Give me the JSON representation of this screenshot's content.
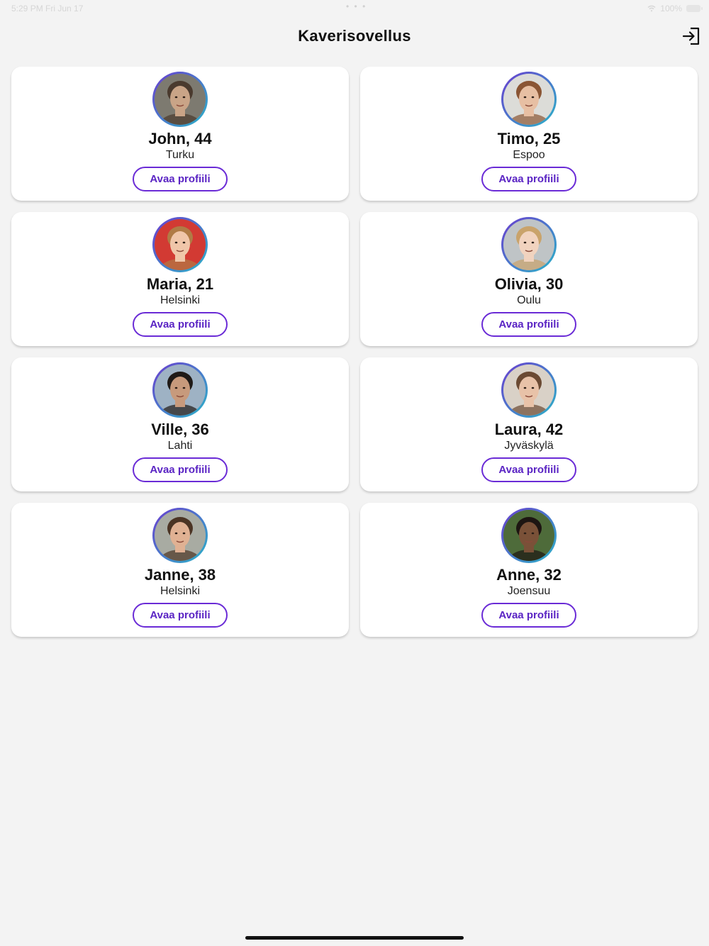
{
  "status_bar": {
    "time": "5:29 PM   Fri Jun 17",
    "dots": "• • •",
    "battery_text": "100%"
  },
  "header": {
    "title": "Kaverisovellus",
    "login_icon": "login-icon"
  },
  "accent_color": "#6a2bd6",
  "profiles": [
    {
      "name": "John, 44",
      "city": "Turku",
      "button": "Avaa profiili",
      "skin": "#c9a487",
      "hair": "#4a3a2e",
      "bg": "#7d7a70"
    },
    {
      "name": "Timo, 25",
      "city": "Espoo",
      "button": "Avaa profiili",
      "skin": "#e7bfa3",
      "hair": "#8a5534",
      "bg": "#dcdcd8"
    },
    {
      "name": "Maria, 21",
      "city": "Helsinki",
      "button": "Avaa profiili",
      "skin": "#f0c6a9",
      "hair": "#b07b45",
      "bg": "#d23a33"
    },
    {
      "name": "Olivia, 30",
      "city": "Oulu",
      "button": "Avaa profiili",
      "skin": "#f1d3bf",
      "hair": "#c9a36b",
      "bg": "#bfc4c6"
    },
    {
      "name": "Ville, 36",
      "city": "Lahti",
      "button": "Avaa profiili",
      "skin": "#c79a7c",
      "hair": "#1f1a17",
      "bg": "#9eb2c4"
    },
    {
      "name": "Laura, 42",
      "city": "Jyväskylä",
      "button": "Avaa profiili",
      "skin": "#e8c2a8",
      "hair": "#6b4a33",
      "bg": "#d9d1c7"
    },
    {
      "name": "Janne, 38",
      "city": "Helsinki",
      "button": "Avaa profiili",
      "skin": "#e0b193",
      "hair": "#4b3424",
      "bg": "#a8aba2"
    },
    {
      "name": "Anne, 32",
      "city": "Joensuu",
      "button": "Avaa profiili",
      "skin": "#7a5138",
      "hair": "#1d1512",
      "bg": "#4e6b3a"
    }
  ]
}
